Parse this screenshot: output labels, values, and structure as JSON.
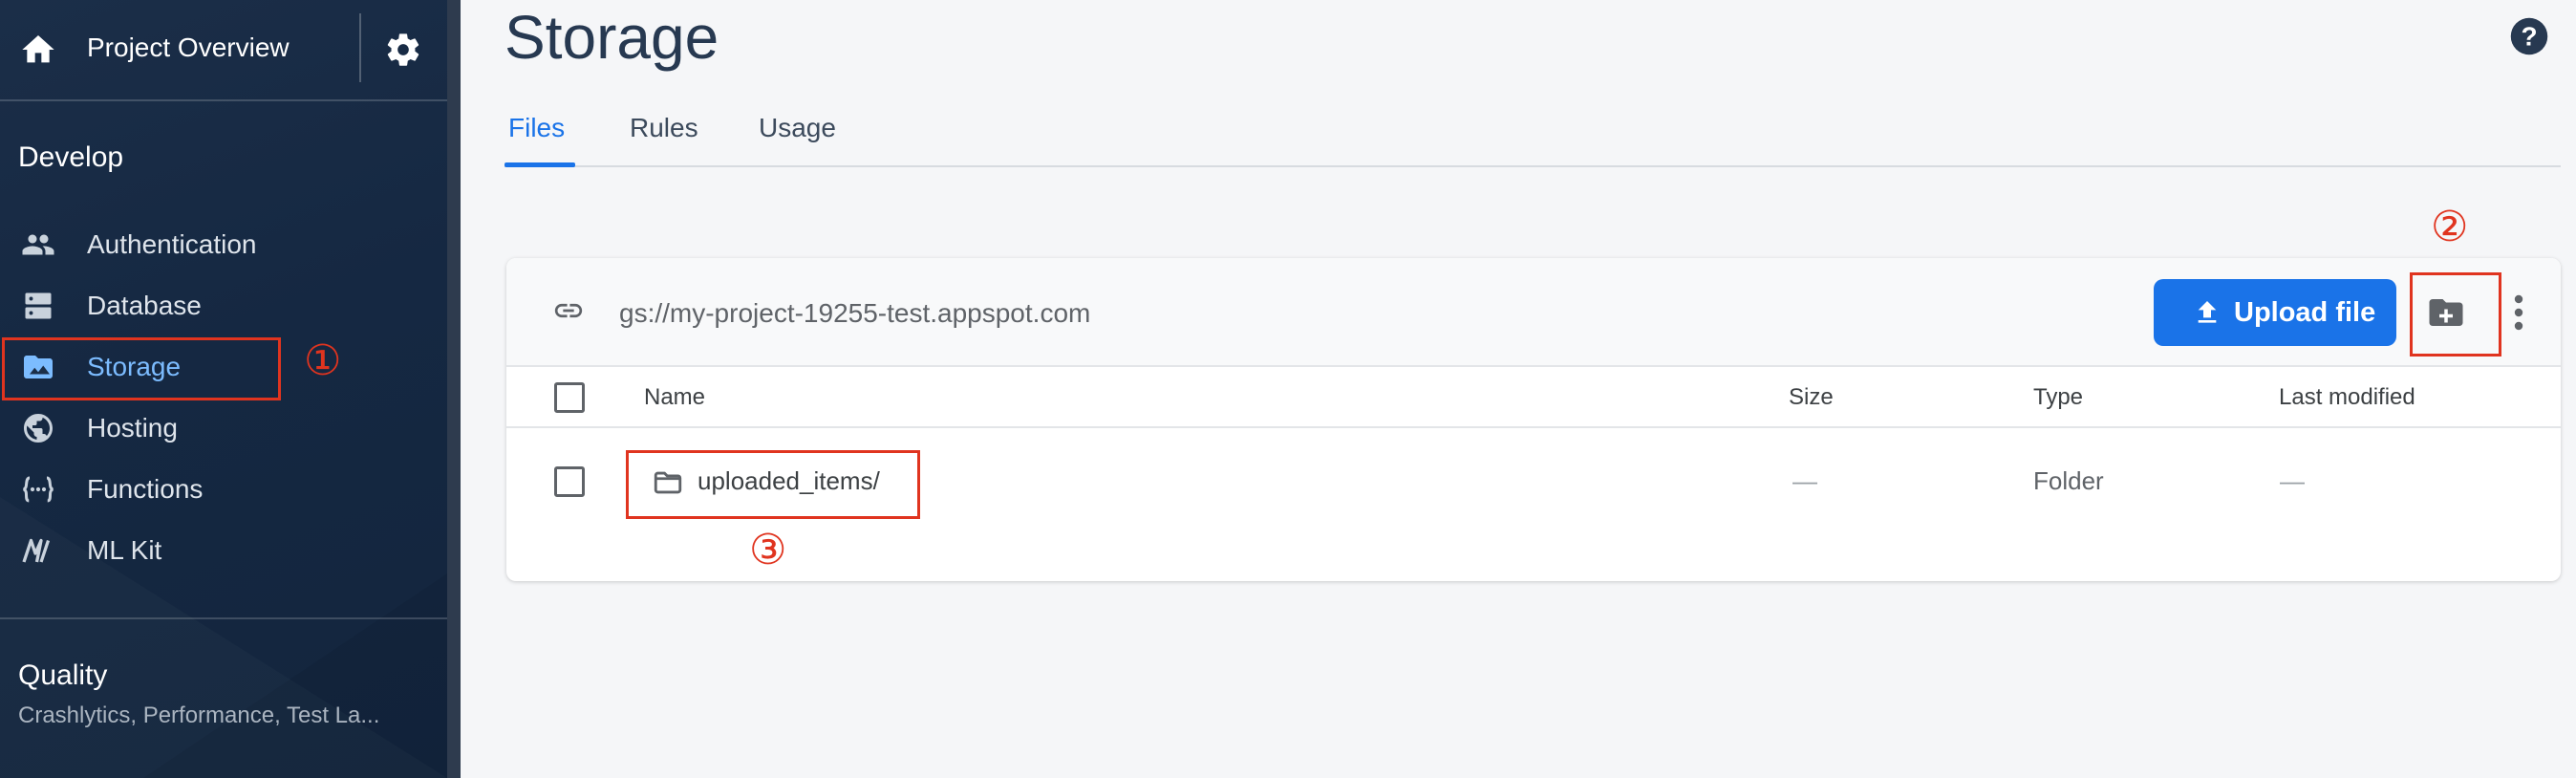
{
  "sidebar": {
    "project_title": "Project Overview",
    "section_develop": "Develop",
    "items": [
      {
        "label": "Authentication",
        "icon": "people-icon"
      },
      {
        "label": "Database",
        "icon": "database-icon"
      },
      {
        "label": "Storage",
        "icon": "image-folder-icon",
        "active": true
      },
      {
        "label": "Hosting",
        "icon": "globe-icon"
      },
      {
        "label": "Functions",
        "icon": "functions-icon"
      },
      {
        "label": "ML Kit",
        "icon": "mlkit-icon"
      }
    ],
    "section_quality": "Quality",
    "quality_sub": "Crashlytics, Performance, Test La..."
  },
  "main": {
    "title": "Storage",
    "tabs": [
      {
        "label": "Files",
        "active": true
      },
      {
        "label": "Rules"
      },
      {
        "label": "Usage"
      }
    ],
    "bucket_url": "gs://my-project-19255-test.appspot.com",
    "upload_label": "Upload file",
    "columns": {
      "name": "Name",
      "size": "Size",
      "type": "Type",
      "last_modified": "Last modified"
    },
    "rows": [
      {
        "name": "uploaded_items/",
        "size": "—",
        "type": "Folder",
        "last_modified": "—"
      }
    ]
  },
  "annotations": {
    "one": "①",
    "two": "②",
    "three": "③"
  },
  "colors": {
    "accent": "#1a73e8",
    "annotation": "#e0341f",
    "sidebar": "#1b2e48"
  }
}
